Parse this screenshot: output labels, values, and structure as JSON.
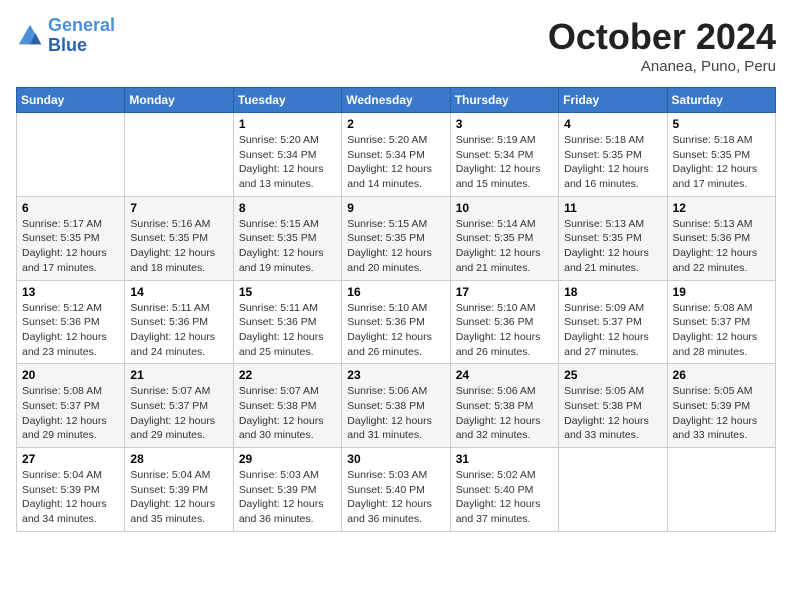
{
  "header": {
    "logo_line1": "General",
    "logo_line2": "Blue",
    "month": "October 2024",
    "location": "Ananea, Puno, Peru"
  },
  "weekdays": [
    "Sunday",
    "Monday",
    "Tuesday",
    "Wednesday",
    "Thursday",
    "Friday",
    "Saturday"
  ],
  "weeks": [
    [
      {
        "day": "",
        "info": ""
      },
      {
        "day": "",
        "info": ""
      },
      {
        "day": "1",
        "info": "Sunrise: 5:20 AM\nSunset: 5:34 PM\nDaylight: 12 hours\nand 13 minutes."
      },
      {
        "day": "2",
        "info": "Sunrise: 5:20 AM\nSunset: 5:34 PM\nDaylight: 12 hours\nand 14 minutes."
      },
      {
        "day": "3",
        "info": "Sunrise: 5:19 AM\nSunset: 5:34 PM\nDaylight: 12 hours\nand 15 minutes."
      },
      {
        "day": "4",
        "info": "Sunrise: 5:18 AM\nSunset: 5:35 PM\nDaylight: 12 hours\nand 16 minutes."
      },
      {
        "day": "5",
        "info": "Sunrise: 5:18 AM\nSunset: 5:35 PM\nDaylight: 12 hours\nand 17 minutes."
      }
    ],
    [
      {
        "day": "6",
        "info": "Sunrise: 5:17 AM\nSunset: 5:35 PM\nDaylight: 12 hours\nand 17 minutes."
      },
      {
        "day": "7",
        "info": "Sunrise: 5:16 AM\nSunset: 5:35 PM\nDaylight: 12 hours\nand 18 minutes."
      },
      {
        "day": "8",
        "info": "Sunrise: 5:15 AM\nSunset: 5:35 PM\nDaylight: 12 hours\nand 19 minutes."
      },
      {
        "day": "9",
        "info": "Sunrise: 5:15 AM\nSunset: 5:35 PM\nDaylight: 12 hours\nand 20 minutes."
      },
      {
        "day": "10",
        "info": "Sunrise: 5:14 AM\nSunset: 5:35 PM\nDaylight: 12 hours\nand 21 minutes."
      },
      {
        "day": "11",
        "info": "Sunrise: 5:13 AM\nSunset: 5:35 PM\nDaylight: 12 hours\nand 21 minutes."
      },
      {
        "day": "12",
        "info": "Sunrise: 5:13 AM\nSunset: 5:36 PM\nDaylight: 12 hours\nand 22 minutes."
      }
    ],
    [
      {
        "day": "13",
        "info": "Sunrise: 5:12 AM\nSunset: 5:36 PM\nDaylight: 12 hours\nand 23 minutes."
      },
      {
        "day": "14",
        "info": "Sunrise: 5:11 AM\nSunset: 5:36 PM\nDaylight: 12 hours\nand 24 minutes."
      },
      {
        "day": "15",
        "info": "Sunrise: 5:11 AM\nSunset: 5:36 PM\nDaylight: 12 hours\nand 25 minutes."
      },
      {
        "day": "16",
        "info": "Sunrise: 5:10 AM\nSunset: 5:36 PM\nDaylight: 12 hours\nand 26 minutes."
      },
      {
        "day": "17",
        "info": "Sunrise: 5:10 AM\nSunset: 5:36 PM\nDaylight: 12 hours\nand 26 minutes."
      },
      {
        "day": "18",
        "info": "Sunrise: 5:09 AM\nSunset: 5:37 PM\nDaylight: 12 hours\nand 27 minutes."
      },
      {
        "day": "19",
        "info": "Sunrise: 5:08 AM\nSunset: 5:37 PM\nDaylight: 12 hours\nand 28 minutes."
      }
    ],
    [
      {
        "day": "20",
        "info": "Sunrise: 5:08 AM\nSunset: 5:37 PM\nDaylight: 12 hours\nand 29 minutes."
      },
      {
        "day": "21",
        "info": "Sunrise: 5:07 AM\nSunset: 5:37 PM\nDaylight: 12 hours\nand 29 minutes."
      },
      {
        "day": "22",
        "info": "Sunrise: 5:07 AM\nSunset: 5:38 PM\nDaylight: 12 hours\nand 30 minutes."
      },
      {
        "day": "23",
        "info": "Sunrise: 5:06 AM\nSunset: 5:38 PM\nDaylight: 12 hours\nand 31 minutes."
      },
      {
        "day": "24",
        "info": "Sunrise: 5:06 AM\nSunset: 5:38 PM\nDaylight: 12 hours\nand 32 minutes."
      },
      {
        "day": "25",
        "info": "Sunrise: 5:05 AM\nSunset: 5:38 PM\nDaylight: 12 hours\nand 33 minutes."
      },
      {
        "day": "26",
        "info": "Sunrise: 5:05 AM\nSunset: 5:39 PM\nDaylight: 12 hours\nand 33 minutes."
      }
    ],
    [
      {
        "day": "27",
        "info": "Sunrise: 5:04 AM\nSunset: 5:39 PM\nDaylight: 12 hours\nand 34 minutes."
      },
      {
        "day": "28",
        "info": "Sunrise: 5:04 AM\nSunset: 5:39 PM\nDaylight: 12 hours\nand 35 minutes."
      },
      {
        "day": "29",
        "info": "Sunrise: 5:03 AM\nSunset: 5:39 PM\nDaylight: 12 hours\nand 36 minutes."
      },
      {
        "day": "30",
        "info": "Sunrise: 5:03 AM\nSunset: 5:40 PM\nDaylight: 12 hours\nand 36 minutes."
      },
      {
        "day": "31",
        "info": "Sunrise: 5:02 AM\nSunset: 5:40 PM\nDaylight: 12 hours\nand 37 minutes."
      },
      {
        "day": "",
        "info": ""
      },
      {
        "day": "",
        "info": ""
      }
    ]
  ]
}
